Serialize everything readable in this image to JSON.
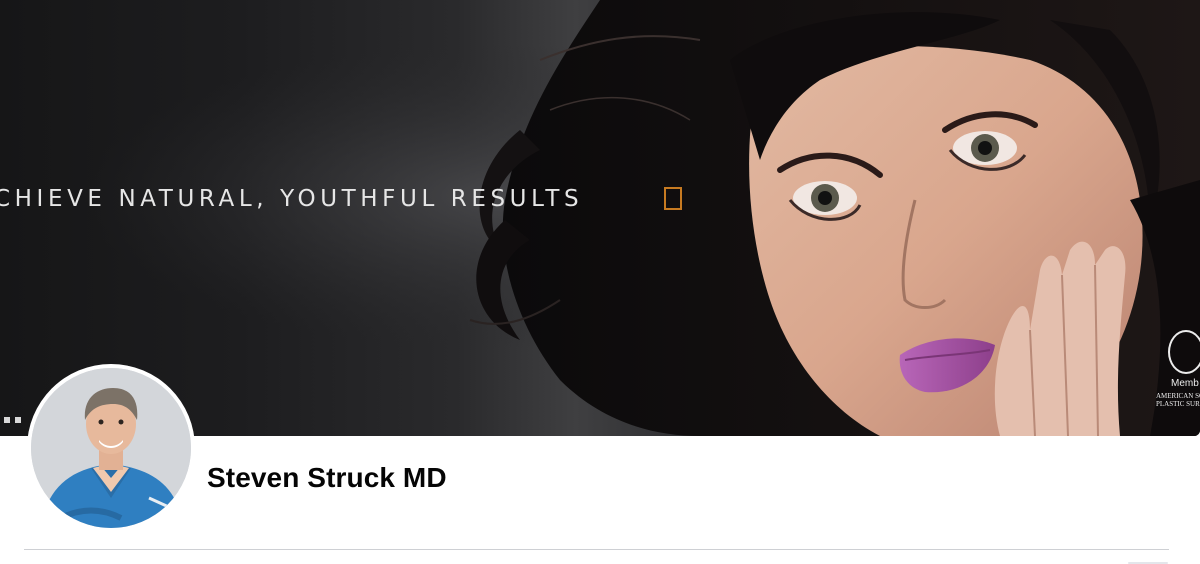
{
  "cover": {
    "tagline": "CHIEVE NATURAL, YOUTHFUL RESULTS",
    "badge": {
      "member_label": "Memb",
      "org_line1": "AMERICAN SO",
      "org_line2": "PLASTIC SUR"
    },
    "accent_color": "#c77a21"
  },
  "profile": {
    "name": "Steven Struck MD"
  }
}
